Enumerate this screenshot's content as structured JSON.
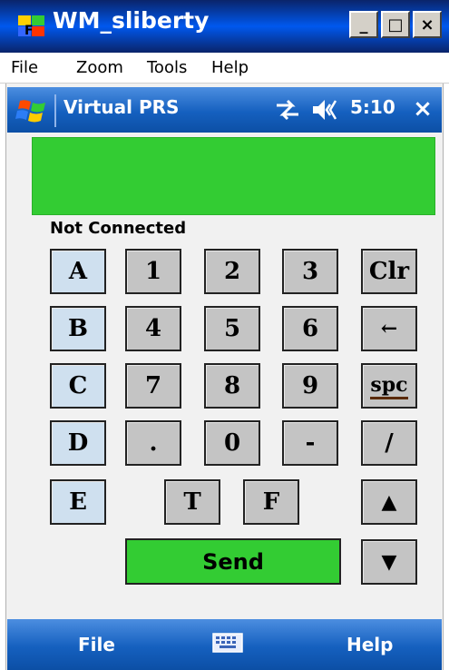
{
  "window": {
    "title": "WM_sliberty",
    "controls": {
      "minimize": "_",
      "maximize": "□",
      "close": "×"
    }
  },
  "menubar": [
    "File",
    "Zoom",
    "Tools",
    "Help"
  ],
  "device": {
    "app_title": "Virtual PRS",
    "clock": "5:10",
    "close_glyph": "×",
    "status": "Not Connected",
    "display_color": "#33cc33",
    "softkeys": {
      "left": "File",
      "right": "Help"
    }
  },
  "keypad": {
    "letters": [
      "A",
      "B",
      "C",
      "D",
      "E"
    ],
    "digits": [
      "1",
      "2",
      "3",
      "4",
      "5",
      "6",
      "7",
      "8",
      "9",
      ".",
      "0",
      "-"
    ],
    "tf": [
      "T",
      "F"
    ],
    "right": [
      "Clr",
      "←",
      "spc",
      "/",
      "▲",
      "▼"
    ],
    "send": "Send"
  },
  "colors": {
    "wm_bar": "#1560bf",
    "letter_key": "#cfe0ef",
    "digit_key": "#c4c4c4",
    "send": "#33cc33"
  }
}
